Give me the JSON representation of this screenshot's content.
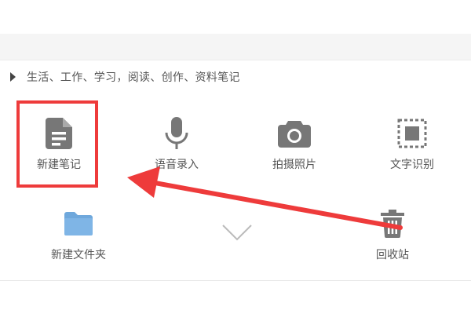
{
  "hint": {
    "text": "生活、工作、学习，阅读、创作、资料笔记"
  },
  "actions": {
    "new_note": "新建笔记",
    "voice_input": "语音录入",
    "take_photo": "拍摄照片",
    "text_recognition": "文字识别",
    "new_folder": "新建文件夹",
    "recycle_bin": "回收站"
  },
  "colors": {
    "icon_gray": "#777777",
    "folder_blue": "#6fa8dc",
    "annotation_red": "#ee3b3b"
  },
  "icons": {
    "new_note": "document-icon",
    "voice_input": "microphone-icon",
    "take_photo": "camera-icon",
    "text_recognition": "scan-text-icon",
    "new_folder": "folder-icon",
    "recycle_bin": "trash-icon",
    "expand": "chevron-down-icon",
    "hint": "triangle-right-icon"
  }
}
